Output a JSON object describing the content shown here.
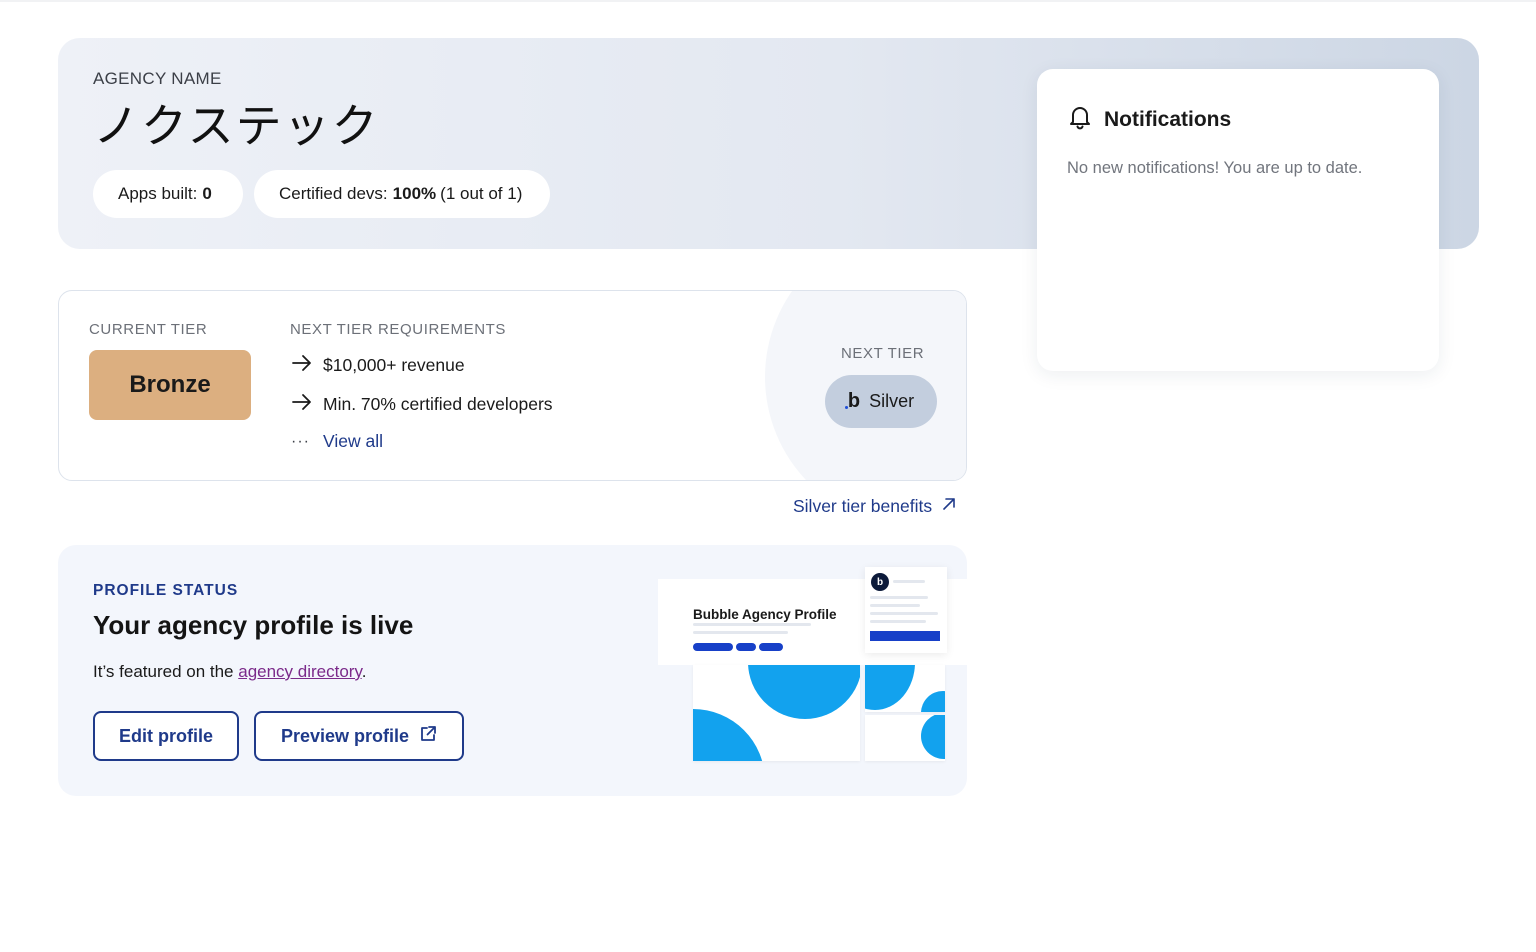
{
  "agency": {
    "label": "AGENCY NAME",
    "name": "ノクステック"
  },
  "stats": {
    "apps_label": "Apps built:",
    "apps_value": "0",
    "certs_label": "Certified devs:",
    "certs_value": "100%",
    "certs_detail": "(1 out of 1)"
  },
  "notifications": {
    "title": "Notifications",
    "empty_text": "No new notifications! You are up to date.",
    "icon": "bell-icon"
  },
  "tier": {
    "current_label": "CURRENT TIER",
    "current_value": "Bronze",
    "requirements_label": "NEXT TIER REQUIREMENTS",
    "requirements": [
      "$10,000+ revenue",
      "Min. 70% certified developers"
    ],
    "view_all": "View all",
    "next_label": "NEXT TIER",
    "next_logo": "b",
    "next_value": "Silver",
    "benefits_link": "Silver tier benefits",
    "colors": {
      "bronze": "#dcaf80",
      "silver": "#c3cede"
    }
  },
  "profile": {
    "status_label": "PROFILE STATUS",
    "title": "Your agency profile is live",
    "text_before": "It’s featured on the ",
    "link_text": "agency directory",
    "text_after": ".",
    "edit_button": "Edit profile",
    "preview_button": "Preview profile",
    "illustration_title": "Bubble Agency Profile",
    "illustration_logo": "b"
  },
  "colors": {
    "accent": "#1f3a8a",
    "illustration_blue": "#12a2ee",
    "link_purple": "#7b2a8a"
  }
}
